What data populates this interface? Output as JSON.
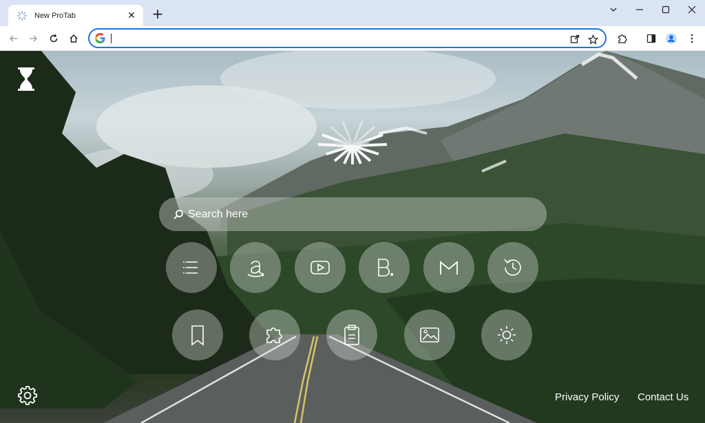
{
  "tab": {
    "title": "New ProTab",
    "close_glyph": "✕"
  },
  "newtab_glyph": "+",
  "window_controls": {
    "minimize": "—",
    "maximize": "☐",
    "close": "✕",
    "tablist": "⌄"
  },
  "omnibox": {
    "value": "",
    "placeholder": ""
  },
  "search": {
    "placeholder": "Search here"
  },
  "shortcuts_row1": [
    {
      "name": "menu",
      "icon": "menu-icon"
    },
    {
      "name": "amazon",
      "icon": "amazon-icon"
    },
    {
      "name": "youtube",
      "icon": "youtube-icon"
    },
    {
      "name": "booking",
      "icon": "booking-icon"
    },
    {
      "name": "gmail",
      "icon": "gmail-icon"
    },
    {
      "name": "history",
      "icon": "history-icon"
    }
  ],
  "shortcuts_row2": [
    {
      "name": "bookmarks",
      "icon": "bookmark-icon"
    },
    {
      "name": "extensions",
      "icon": "puzzle-icon"
    },
    {
      "name": "clipboard",
      "icon": "clipboard-icon"
    },
    {
      "name": "wallpaper",
      "icon": "image-icon"
    },
    {
      "name": "theme",
      "icon": "sun-icon"
    }
  ],
  "footer": {
    "privacy": "Privacy Policy",
    "contact": "Contact Us"
  },
  "colors": {
    "accent": "#1a73e8",
    "tabstrip": "#dbe4f4"
  }
}
